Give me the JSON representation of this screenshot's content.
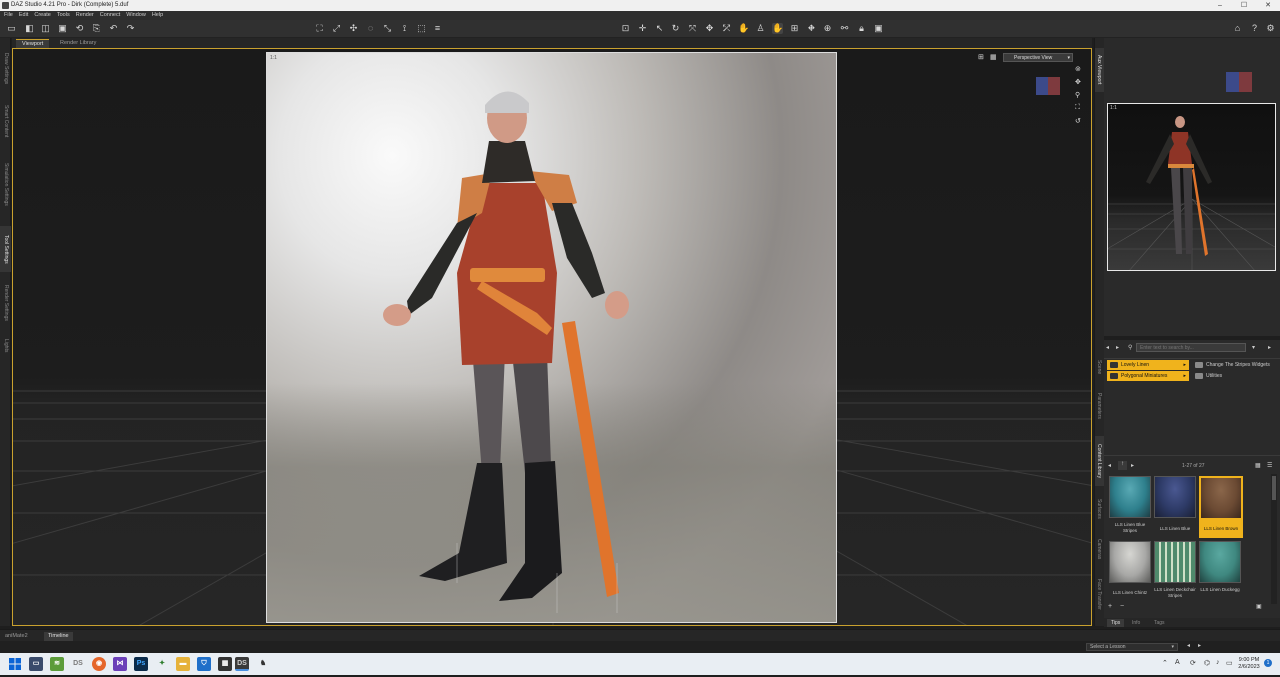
{
  "window": {
    "title": "DAZ Studio 4.21 Pro - Dirk (Complete) 5.duf",
    "min": "–",
    "max": "☐",
    "close": "✕"
  },
  "menu": [
    "File",
    "Edit",
    "Create",
    "Tools",
    "Render",
    "Connect",
    "Window",
    "Help"
  ],
  "left_tabs": [
    "Draw Settings",
    "Smart Content",
    "Simulation Settings",
    "Tool Settings",
    "Render Settings",
    "Lights"
  ],
  "viewport_tabs": [
    "Viewport",
    "Render Library"
  ],
  "viewport": {
    "corner_label": "1:1",
    "view_select": "Perspective View"
  },
  "aux": {
    "tab": "Aux Viewport",
    "corner_label": "1:1"
  },
  "right_tabs": [
    "Scene",
    "Parameters",
    "Content Library",
    "Surfaces",
    "Cameras",
    "Face Transfer"
  ],
  "content_library": {
    "search_placeholder": "Enter text to search by...",
    "categories": [
      {
        "label": "Lovely Linen"
      },
      {
        "label": "Polygonal Miniatures"
      }
    ],
    "folders": [
      "Change The Stripes Widgets",
      "Utilities"
    ],
    "count": "1-27 of 27",
    "items": [
      {
        "label": "LLS Linen Blue Stripes",
        "color": "#2e7f8c",
        "selected": false
      },
      {
        "label": "LLS Linen Blue",
        "color": "#2d3a66",
        "selected": false
      },
      {
        "label": "LLS Linen Brown",
        "color": "#6b4a33",
        "selected": true
      },
      {
        "label": "LLS Linen Chintz",
        "color": "#a8a8a6",
        "selected": false
      },
      {
        "label": "LLS Linen Deckchair Stripes",
        "color": "#4f8a6c",
        "selected": false
      },
      {
        "label": "LLS Linen Duckegg",
        "color": "#3f8880",
        "selected": false
      }
    ],
    "bottom_tabs": [
      "Tips",
      "Info",
      "Tags"
    ]
  },
  "bottom_panes": [
    "aniMate2",
    "Timeline"
  ],
  "lesson": {
    "placeholder": "Select a Lesson"
  },
  "taskbar": {
    "apps": [
      "start",
      "monitor",
      "stack",
      "DS",
      "firefox",
      "visual-studio",
      "photoshop",
      "hexagon",
      "explorer",
      "shield",
      "calculator",
      "DS",
      "figure"
    ],
    "time": "9:00 PM",
    "date": "2/6/2023"
  },
  "colors": {
    "accent": "#c9a12e",
    "selected": "#f0b31c"
  }
}
